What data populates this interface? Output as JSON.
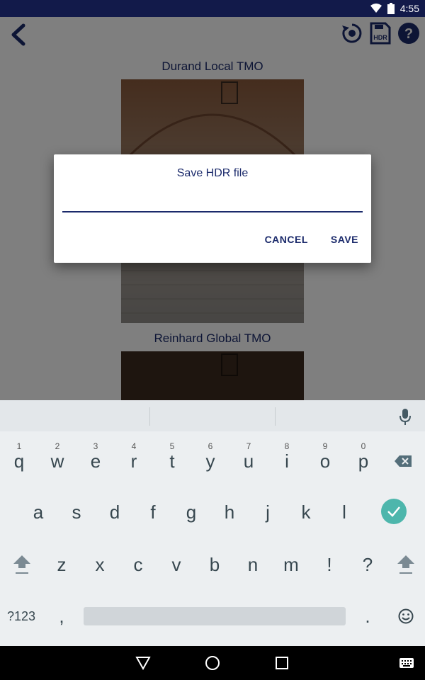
{
  "status": {
    "time": "4:55"
  },
  "app": {
    "sections": [
      {
        "title": "Durand Local TMO"
      },
      {
        "title": "Reinhard Global TMO"
      }
    ],
    "toolbar": {
      "hdr_label": "HDR"
    }
  },
  "dialog": {
    "title": "Save HDR file",
    "input_value": "",
    "cancel_label": "CANCEL",
    "save_label": "SAVE"
  },
  "keyboard": {
    "row1": [
      {
        "k": "q",
        "h": "1"
      },
      {
        "k": "w",
        "h": "2"
      },
      {
        "k": "e",
        "h": "3"
      },
      {
        "k": "r",
        "h": "4"
      },
      {
        "k": "t",
        "h": "5"
      },
      {
        "k": "y",
        "h": "6"
      },
      {
        "k": "u",
        "h": "7"
      },
      {
        "k": "i",
        "h": "8"
      },
      {
        "k": "o",
        "h": "9"
      },
      {
        "k": "p",
        "h": "0"
      }
    ],
    "row2": [
      "a",
      "s",
      "d",
      "f",
      "g",
      "h",
      "j",
      "k",
      "l"
    ],
    "row3": [
      "z",
      "x",
      "c",
      "v",
      "b",
      "n",
      "m",
      "!",
      "?"
    ],
    "symbols_label": "?123",
    "comma_label": ",",
    "period_label": "."
  },
  "colors": {
    "accent": "#1b2a6b",
    "statusbar": "#121a4a",
    "enter": "#4db6ac"
  }
}
